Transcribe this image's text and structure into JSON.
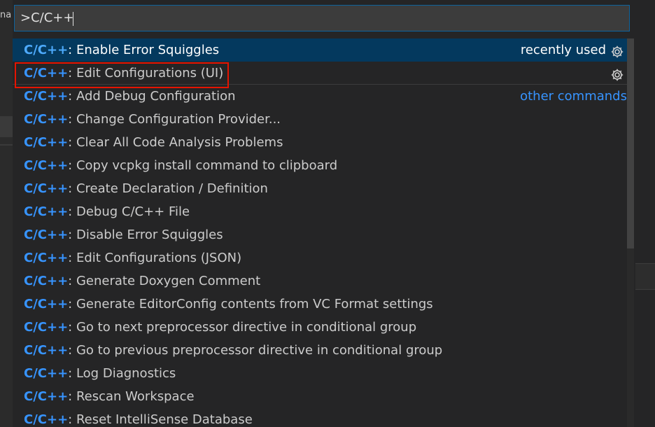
{
  "background": {
    "left_fragment": "na"
  },
  "search": {
    "value": ">C/C++"
  },
  "list": {
    "prefix": "C/C++",
    "rows": [
      {
        "text": ": Enable Error Squiggles",
        "right": "recently used",
        "gear": true
      },
      {
        "text": ": Edit Configurations (UI)",
        "gear": true
      },
      {
        "text": ": Add Debug Configuration",
        "link": "other commands"
      },
      {
        "text": ": Change Configuration Provider..."
      },
      {
        "text": ": Clear All Code Analysis Problems"
      },
      {
        "text": ": Copy vcpkg install command to clipboard"
      },
      {
        "text": ": Create Declaration / Definition"
      },
      {
        "text": ": Debug C/C++ File"
      },
      {
        "text": ": Disable Error Squiggles"
      },
      {
        "text": ": Edit Configurations (JSON)"
      },
      {
        "text": ": Generate Doxygen Comment"
      },
      {
        "text": ": Generate EditorConfig contents from VC Format settings"
      },
      {
        "text": ": Go to next preprocessor directive in conditional group"
      },
      {
        "text": ": Go to previous preprocessor directive in conditional group"
      },
      {
        "text": ": Log Diagnostics"
      },
      {
        "text": ": Rescan Workspace"
      },
      {
        "text": ": Reset IntelliSense Database"
      }
    ]
  },
  "colors": {
    "accent": "#3794ff",
    "selection": "#04395e",
    "annotation_box": "#e51400"
  },
  "icons": {
    "row_action": "gear-icon"
  }
}
